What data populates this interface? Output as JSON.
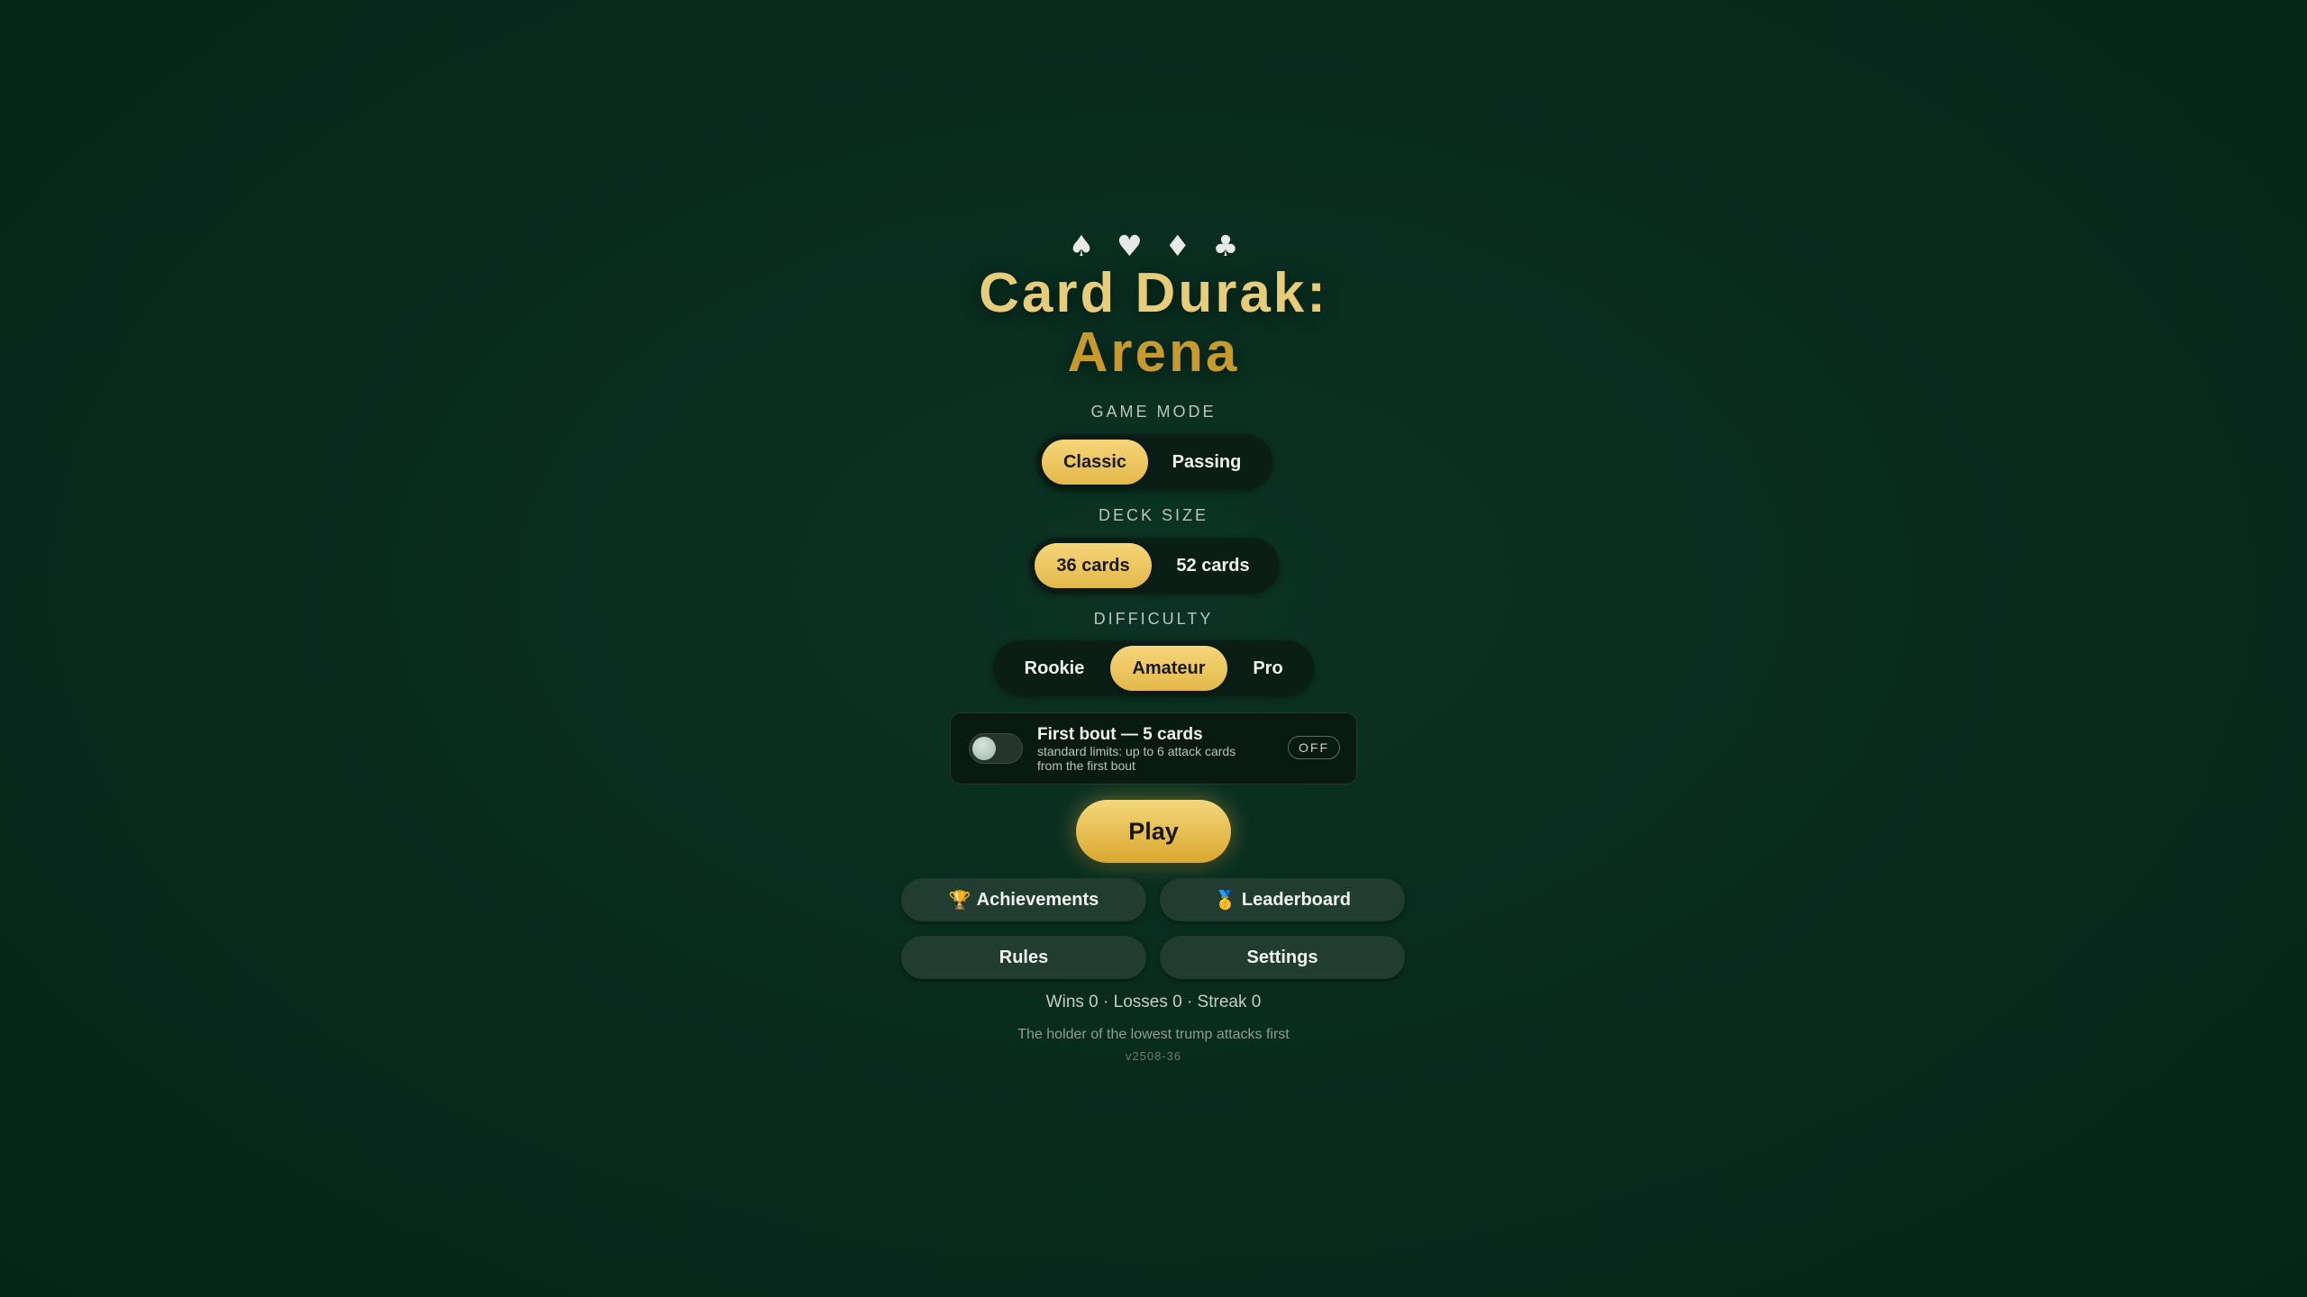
{
  "header": {
    "suits": [
      {
        "glyph": "♠",
        "icon": "spade-icon"
      },
      {
        "glyph": "♥",
        "icon": "heart-icon"
      },
      {
        "glyph": "♦",
        "icon": "diamond-icon"
      },
      {
        "glyph": "♣",
        "icon": "club-icon"
      }
    ],
    "title_line1": "Card Durak:",
    "title_line2": "Arena"
  },
  "game_mode": {
    "label": "GAME MODE",
    "options": [
      "Classic",
      "Passing"
    ],
    "selected": "Classic"
  },
  "deck_size": {
    "label": "DECK SIZE",
    "options": [
      "36 cards",
      "52 cards"
    ],
    "selected": "36 cards"
  },
  "difficulty": {
    "label": "DIFFICULTY",
    "options": [
      "Rookie",
      "Amateur",
      "Pro"
    ],
    "selected": "Amateur"
  },
  "first_bout": {
    "title": "First bout — 5 cards",
    "description": "standard limits: up to 6 attack cards from the first bout",
    "state_label": "OFF",
    "enabled": false
  },
  "actions": {
    "play_label": "Play",
    "achievements_label": "Achievements",
    "achievements_icon": "🏆",
    "leaderboard_label": "Leaderboard",
    "leaderboard_icon": "🥇",
    "rules_label": "Rules",
    "settings_label": "Settings"
  },
  "footer": {
    "stats": "Wins 0 · Losses 0 · Streak 0",
    "tip": "The holder of the lowest trump attacks first",
    "version": "v2508-36"
  },
  "colors": {
    "accent_gold": "#e3b84a",
    "title_gold_light": "#e7cd79",
    "title_gold_dark": "#c79a2e",
    "background": "#082a1d"
  }
}
